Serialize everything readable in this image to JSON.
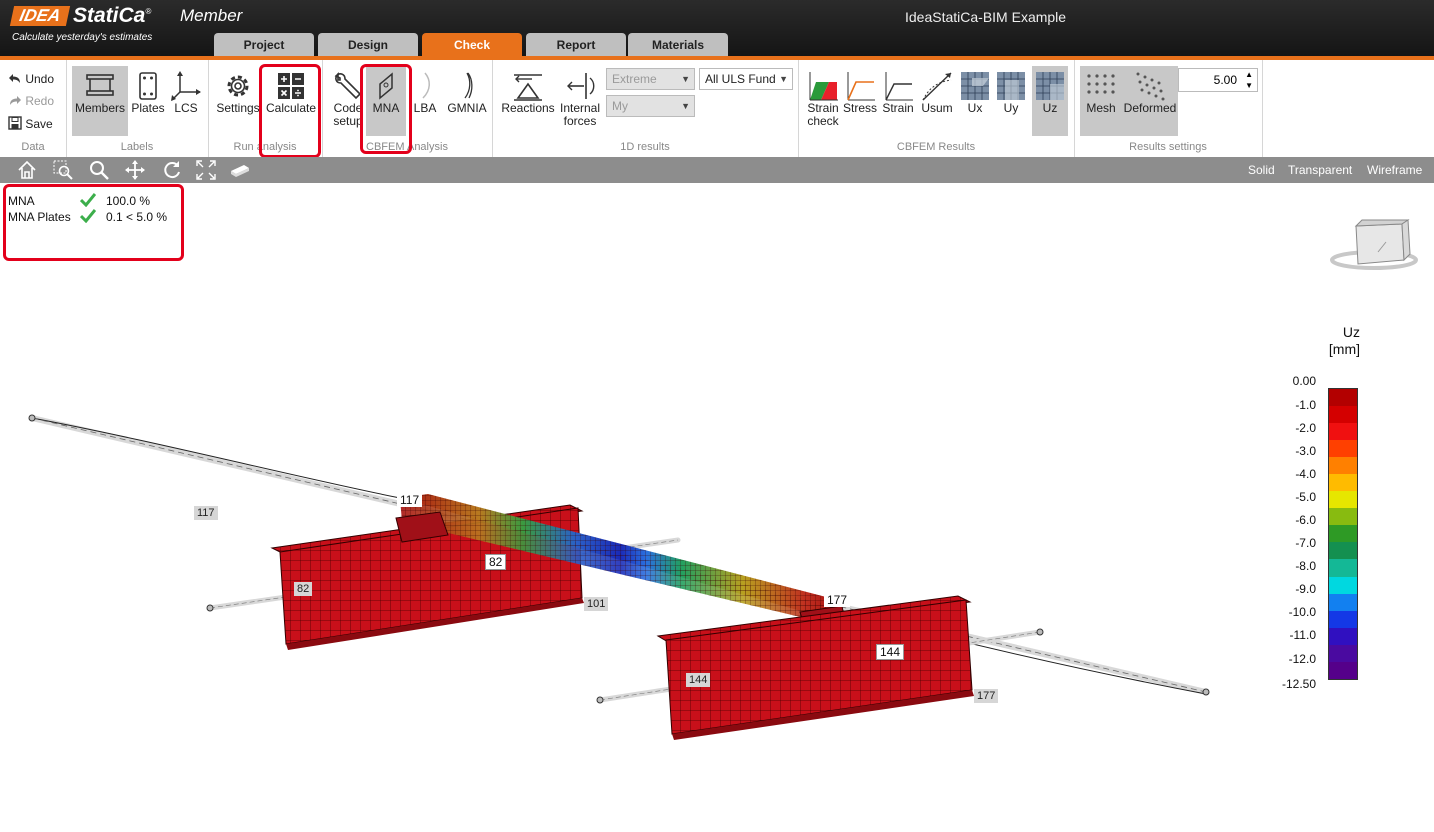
{
  "app": {
    "logo_idea": "IDEA",
    "logo_statica": "StatiCa",
    "logo_mark": "®",
    "product": "Member",
    "slogan": "Calculate yesterday's estimates",
    "window_title": "IdeaStatiCa-BIM Example"
  },
  "tabs": [
    "Project",
    "Design",
    "Check",
    "Report",
    "Materials"
  ],
  "active_tab": "Check",
  "ribbon": {
    "data": {
      "undo": "Undo",
      "redo": "Redo",
      "save": "Save",
      "label": "Data"
    },
    "labels": {
      "members": "Members",
      "plates": "Plates",
      "lcs": "LCS",
      "label": "Labels"
    },
    "run": {
      "settings": "Settings",
      "calculate": "Calculate",
      "label": "Run analysis"
    },
    "cbfem_analysis": {
      "code_setup": "Code setup",
      "mna": "MNA",
      "lba": "LBA",
      "gmnia": "GMNIA",
      "label": "CBFEM Analysis"
    },
    "results_1d": {
      "reactions": "Reactions",
      "internal_forces": "Internal forces",
      "extreme": "Extreme",
      "my": "My",
      "load_combo": "All ULS Fund",
      "label": "1D results"
    },
    "cbfem_results": {
      "strain_check": "Strain check",
      "stress": "Stress",
      "strain": "Strain",
      "usum": "Usum",
      "ux": "Ux",
      "uy": "Uy",
      "uz": "Uz",
      "label": "CBFEM Results"
    },
    "results_settings": {
      "mesh": "Mesh",
      "deformed": "Deformed",
      "scale": "5.00",
      "label": "Results settings"
    }
  },
  "view_modes": [
    "Solid",
    "Transparent",
    "Wireframe"
  ],
  "status": [
    {
      "name": "MNA",
      "value": "100.0 %"
    },
    {
      "name": "MNA Plates",
      "value": "0.1 < 5.0 %"
    }
  ],
  "legend": {
    "title": "Uz",
    "unit": "[mm]",
    "ticks": [
      "0.00",
      "-1.0",
      "-2.0",
      "-3.0",
      "-4.0",
      "-5.0",
      "-6.0",
      "-7.0",
      "-8.0",
      "-9.0",
      "-10.0",
      "-11.0",
      "-12.0",
      "-12.50"
    ],
    "colors": [
      "#b30000",
      "#d40000",
      "#f01010",
      "#ff4000",
      "#ff8000",
      "#ffbb00",
      "#e6e600",
      "#88bb10",
      "#2e9a25",
      "#149050",
      "#14b896",
      "#00d8e0",
      "#1280f0",
      "#1438e6",
      "#3010c0",
      "#4a0aa0",
      "#55008a"
    ]
  },
  "node_labels": {
    "grey": [
      {
        "text": "117",
        "key": "l117"
      },
      {
        "text": "82",
        "key": "l82"
      },
      {
        "text": "101",
        "key": "l101"
      },
      {
        "text": "144",
        "key": "l144"
      },
      {
        "text": "177",
        "key": "l177"
      }
    ],
    "white": [
      {
        "text": "117",
        "key": "w117"
      },
      {
        "text": "82",
        "key": "w82"
      },
      {
        "text": "177",
        "key": "w177"
      },
      {
        "text": "144",
        "key": "w144"
      }
    ]
  }
}
